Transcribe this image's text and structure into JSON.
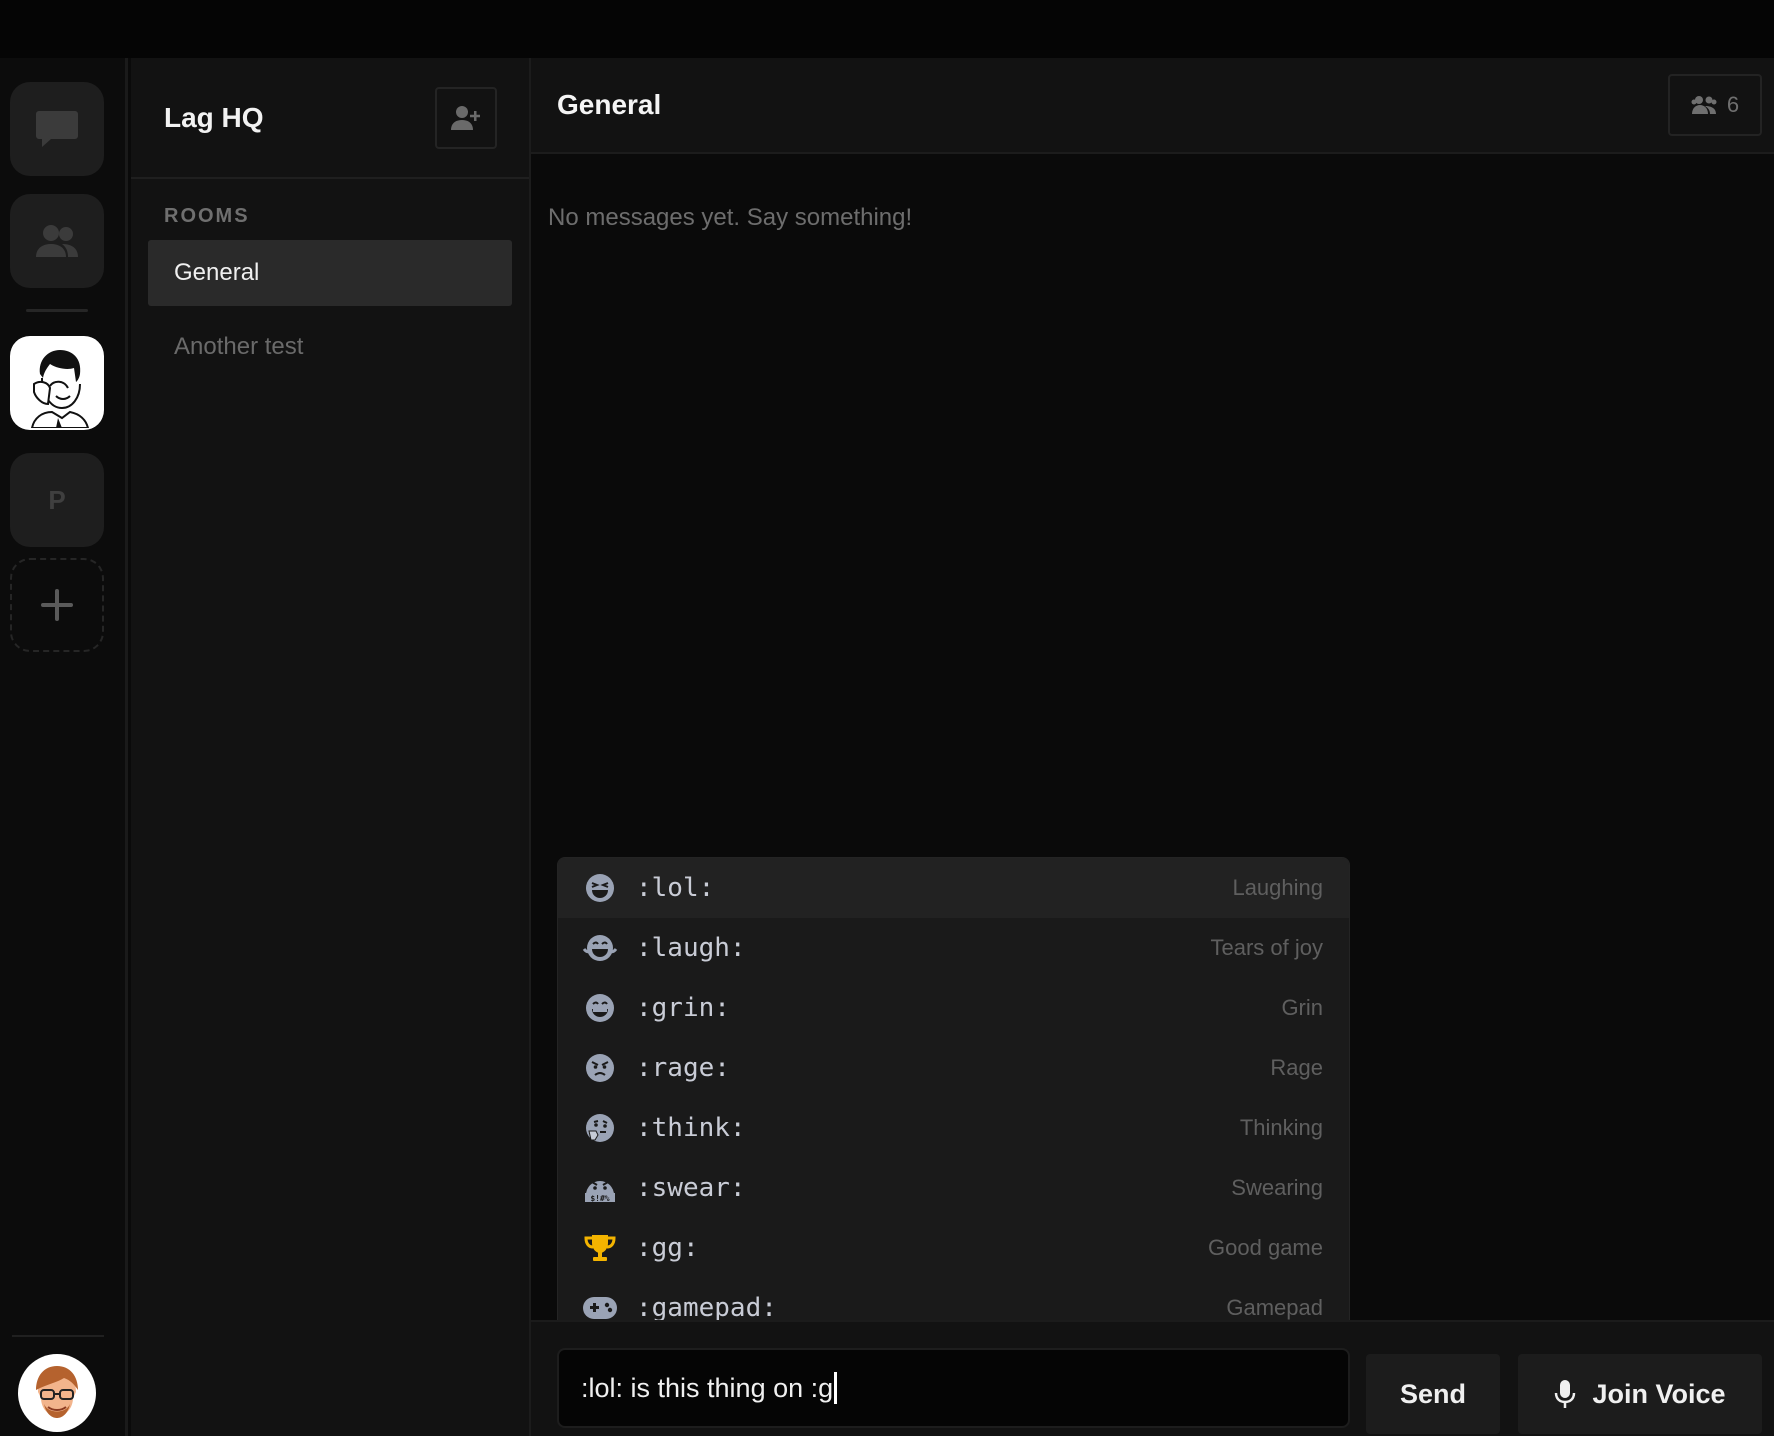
{
  "server": {
    "name": "Lag HQ"
  },
  "rail": {
    "letter_server": "P"
  },
  "channels": {
    "section_label": "ROOMS",
    "rooms": [
      {
        "label": "General",
        "active": true
      },
      {
        "label": "Another test",
        "active": false
      }
    ]
  },
  "main": {
    "channel_title": "General",
    "member_count": "6",
    "empty_message": "No messages yet. Say something!"
  },
  "emoji_suggestions": [
    {
      "icon": "laughing-face-icon",
      "code": ":lol:",
      "description": "Laughing",
      "selected": true
    },
    {
      "icon": "tears-of-joy-face-icon",
      "code": ":laugh:",
      "description": "Tears of joy",
      "selected": false
    },
    {
      "icon": "grinning-face-icon",
      "code": ":grin:",
      "description": "Grin",
      "selected": false
    },
    {
      "icon": "angry-face-icon",
      "code": ":rage:",
      "description": "Rage",
      "selected": false
    },
    {
      "icon": "thinking-face-icon",
      "code": ":think:",
      "description": "Thinking",
      "selected": false
    },
    {
      "icon": "swearing-face-icon",
      "code": ":swear:",
      "description": "Swearing",
      "selected": false
    },
    {
      "icon": "trophy-icon",
      "code": ":gg:",
      "description": "Good game",
      "selected": false
    },
    {
      "icon": "gamepad-icon",
      "code": ":gamepad:",
      "description": "Gamepad",
      "selected": false
    }
  ],
  "composer": {
    "value": ":lol: is this thing on :g",
    "send_label": "Send",
    "voice_label": "Join Voice"
  },
  "colors": {
    "emoji_gray": "#9aa3b5",
    "trophy_gold": "#f4b400"
  }
}
